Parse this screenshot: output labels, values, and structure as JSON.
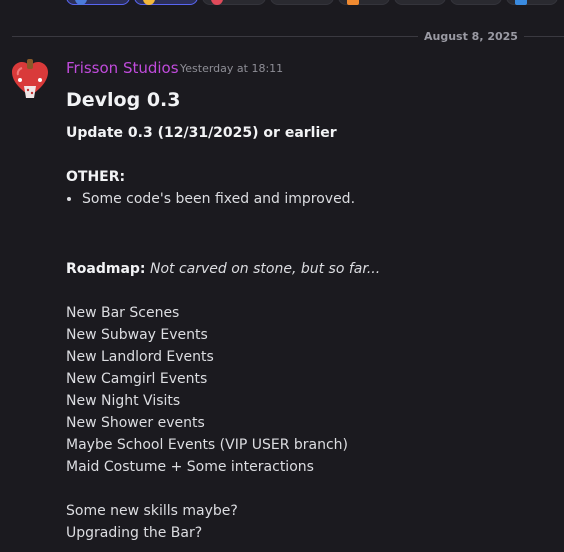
{
  "colors": {
    "background": "#1b1a1f",
    "author": "#c04bdb",
    "text": "#dcdde1",
    "muted": "#8e8e96",
    "divider": "#3a3940",
    "reaction_active": "#5865f2"
  },
  "divider": {
    "date": "August 8, 2025"
  },
  "message": {
    "author": "Frisson Studios",
    "timestamp": "Yesterday at 18:11",
    "avatar_icon": "heart-mascot-avatar",
    "title": "Devlog 0.3",
    "subtitle": "Update 0.3 (12/31/2025) or earlier",
    "other_heading": "OTHER:",
    "other_items": [
      "Some code's been fixed and improved."
    ],
    "roadmap_label": "Roadmap:",
    "roadmap_note": "Not carved on stone, but so far...",
    "roadmap_items": [
      "New Bar Scenes",
      "New Subway Events",
      "New Landlord Events",
      "New Camgirl Events",
      "New Night Visits",
      "New Shower events",
      "Maybe School Events (VIP USER branch)",
      "Maid Costume + Some interactions"
    ],
    "extra_lines": [
      "Some new skills maybe?",
      "Upgrading the Bar?"
    ]
  },
  "reactions": [
    {
      "icon": "blue-emoji-icon",
      "active": true
    },
    {
      "icon": "smile-emoji-icon",
      "active": true
    },
    {
      "icon": "red-emoji-icon",
      "active": false
    },
    {
      "icon": "emoji-icon",
      "active": false
    },
    {
      "icon": "orange-emoji-icon",
      "active": false
    },
    {
      "icon": "emoji-icon",
      "active": false
    },
    {
      "icon": "emoji-icon",
      "active": false
    },
    {
      "icon": "blue-square-emoji-icon",
      "active": false
    }
  ]
}
